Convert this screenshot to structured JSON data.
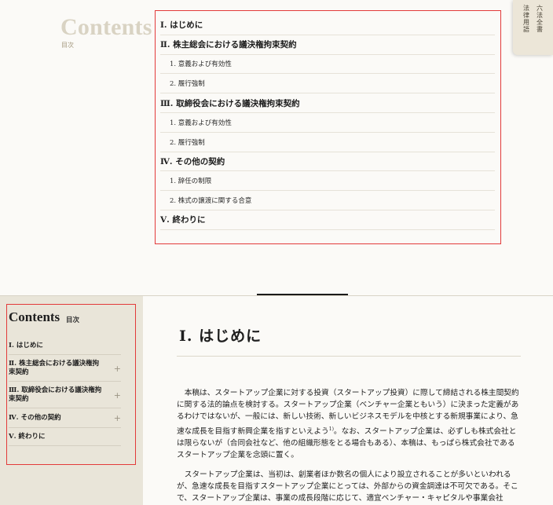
{
  "top_panel": {
    "heading": "Contents",
    "heading_sub": "目次",
    "toc": [
      {
        "level": "main",
        "label": "Ⅰ. はじめに"
      },
      {
        "level": "main",
        "label": "Ⅱ. 株主総会における議決権拘束契約"
      },
      {
        "level": "sub",
        "label": "1. 意義および有効性"
      },
      {
        "level": "sub",
        "label": "2. 履行強制"
      },
      {
        "level": "main",
        "label": "Ⅲ. 取締役会における議決権拘束契約"
      },
      {
        "level": "sub",
        "label": "1. 意義および有効性"
      },
      {
        "level": "sub",
        "label": "2. 履行強制"
      },
      {
        "level": "main",
        "label": "Ⅳ. その他の契約"
      },
      {
        "level": "sub",
        "label": "1. 辞任の制限"
      },
      {
        "level": "sub",
        "label": "2. 株式の譲渡に関する合意"
      },
      {
        "level": "main",
        "label": "Ⅴ. 終わりに"
      }
    ],
    "side_tab": [
      "法律用語",
      "六法全書"
    ]
  },
  "sidebar": {
    "title": "Contents",
    "title_sub": "目次",
    "items": [
      {
        "label": "Ⅰ. はじめに",
        "plus": ""
      },
      {
        "label": "Ⅱ. 株主総会における議決権拘束契約",
        "plus": "+"
      },
      {
        "label": "Ⅲ. 取締役会における議決権拘束契約",
        "plus": "+"
      },
      {
        "label": "Ⅳ. その他の契約",
        "plus": "+"
      },
      {
        "label": "Ⅴ. 終わりに",
        "plus": ""
      }
    ]
  },
  "article": {
    "title": "Ⅰ. はじめに",
    "para1": "本稿は、スタートアップ企業に対する投資（スタートアップ投資）に際して締結される株主間契約に関する法的論点を検討する。スタートアップ企業（ベンチャー企業ともいう）に決まった定義があるわけではないが、一般には、新しい技術、新しいビジネスモデルを中核とする新規事業により、急速な成長を目指す新興企業を指すといえよう",
    "para1_sup": "1)",
    "para1_rest": "。なお、スタートアップ企業は、必ずしも株式会社とは限らないが（合同会社など、他の組織形態をとる場合もある）、本稿は、もっぱら株式会社であるスタートアップ企業を念頭に置く。",
    "para2": "スタートアップ企業は、当初は、創業者ほか数名の個人により設立されることが多いといわれるが、急速な成長を目指すスタートアップ企業にとっては、外部からの資金調達は不可欠である。そこで、スタートアップ企業は、事業の成長段階に応じて、適宜ベンチャー・キャピタルや事業会社"
  }
}
